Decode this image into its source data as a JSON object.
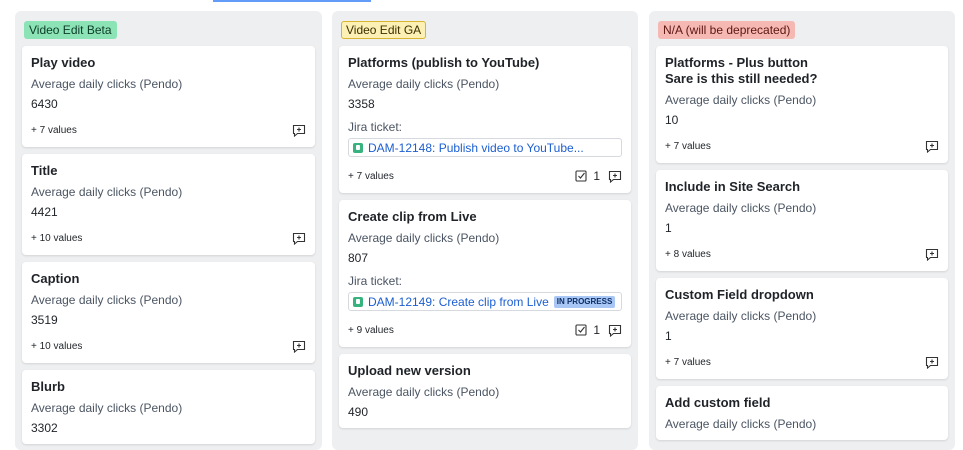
{
  "columns": [
    {
      "tag": "Video Edit Beta",
      "cards": [
        {
          "title": "Play video",
          "label": "Average daily clicks (Pendo)",
          "value": "6430",
          "more": "+ 7 values"
        },
        {
          "title": "Title",
          "label": "Average daily clicks (Pendo)",
          "value": "4421",
          "more": "+ 10 values"
        },
        {
          "title": "Caption",
          "label": "Average daily clicks (Pendo)",
          "value": "3519",
          "more": "+ 10 values"
        },
        {
          "title": "Blurb",
          "label": "Average daily clicks (Pendo)",
          "value": "3302"
        }
      ]
    },
    {
      "tag": "Video Edit GA",
      "cards": [
        {
          "title": "Platforms (publish to YouTube)",
          "label": "Average daily clicks (Pendo)",
          "value": "3358",
          "jira_label": "Jira ticket:",
          "jira_link": "DAM-12148: Publish video to YouTube...",
          "more": "+ 7 values",
          "check_count": "1"
        },
        {
          "title": "Create clip from Live",
          "label": "Average daily clicks (Pendo)",
          "value": "807",
          "jira_label": "Jira ticket:",
          "jira_link": "DAM-12149: Create clip from Live",
          "jira_status": "IN PROGRESS",
          "more": "+ 9 values",
          "check_count": "1"
        },
        {
          "title": "Upload new version",
          "label": "Average daily clicks (Pendo)",
          "value": "490"
        }
      ]
    },
    {
      "tag": "N/A (will be deprecated)",
      "cards": [
        {
          "title_line1": "Platforms - Plus button",
          "title_line2": "Sare is this still needed?",
          "label": "Average daily clicks (Pendo)",
          "value": "10",
          "more": "+ 7 values"
        },
        {
          "title": "Include in Site Search",
          "label": "Average daily clicks (Pendo)",
          "value": "1",
          "more": "+ 8 values"
        },
        {
          "title": "Custom Field dropdown",
          "label": "Average daily clicks (Pendo)",
          "value": "1",
          "more": "+ 7 values"
        },
        {
          "title": "Add custom field",
          "label": "Average daily clicks (Pendo)"
        }
      ]
    }
  ],
  "colors": {
    "tag_beta": "#8ce3b6",
    "tag_ga": "#fdf0b4",
    "tag_deprecated": "#f6b8b3",
    "link": "#1d5fd1",
    "status_in_progress": "#a9c7f5"
  },
  "icons": {
    "add_comment": "comment-plus-icon",
    "checklist": "checkbox-icon",
    "jira": "jira-story-icon"
  }
}
